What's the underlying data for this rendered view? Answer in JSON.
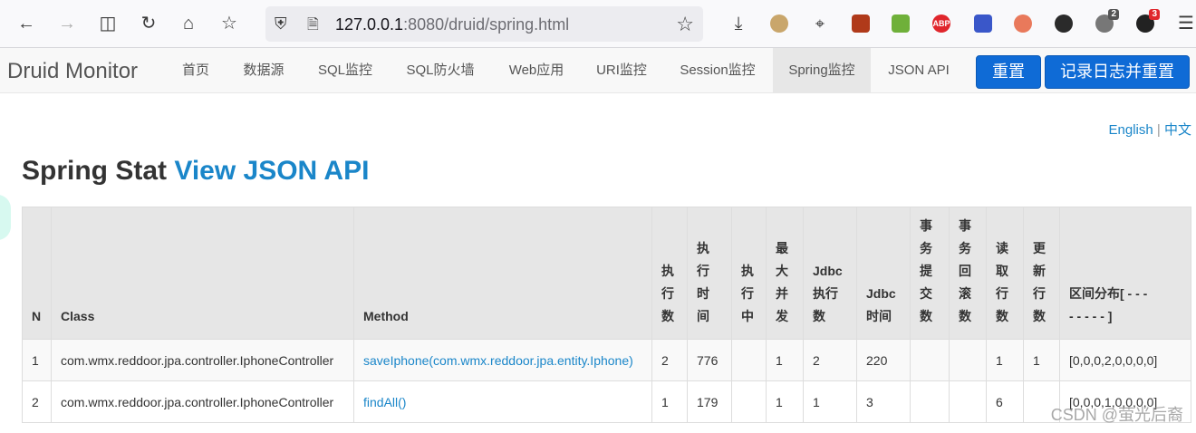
{
  "browser": {
    "url_host": "127.0.0.1",
    "url_rest": ":8080/druid/spring.html",
    "extensions": [
      {
        "name": "download-icon"
      },
      {
        "name": "extension-dog-icon"
      },
      {
        "name": "crop-icon"
      },
      {
        "name": "extension-sun-icon"
      },
      {
        "name": "extension-puzzle-icon"
      },
      {
        "name": "adblock-icon",
        "label": "ABP"
      },
      {
        "name": "extension-translate-icon"
      },
      {
        "name": "extension-tree-icon"
      },
      {
        "name": "extension-dots-icon"
      },
      {
        "name": "extension-ring-icon",
        "badge": "2"
      },
      {
        "name": "extension-face-icon",
        "badge": "3"
      }
    ]
  },
  "header": {
    "brand": "Druid Monitor",
    "nav": [
      "首页",
      "数据源",
      "SQL监控",
      "SQL防火墙",
      "Web应用",
      "URI监控",
      "Session监控",
      "Spring监控",
      "JSON API"
    ],
    "active_nav": "Spring监控",
    "reset_label": "重置",
    "log_reset_label": "记录日志并重置"
  },
  "lang": {
    "english": "English",
    "sep": "|",
    "chinese": "中文"
  },
  "title": {
    "main": "Spring Stat",
    "link": "View JSON API"
  },
  "table": {
    "headers": [
      "N",
      "Class",
      "Method",
      "执行数",
      "执行时间",
      "执行中",
      "最大并发",
      "Jdbc执行数",
      "Jdbc时间",
      "事务提交数",
      "事务回滚数",
      "读取行数",
      "更新行数",
      "区间分布[ - - - - - - - - ]"
    ],
    "rows": [
      [
        "1",
        "com.wmx.reddoor.jpa.controller.IphoneController",
        "saveIphone(com.wmx.reddoor.jpa.entity.Iphone)",
        "2",
        "776",
        "",
        "1",
        "2",
        "220",
        "",
        "",
        "1",
        "1",
        "[0,0,0,2,0,0,0,0]"
      ],
      [
        "2",
        "com.wmx.reddoor.jpa.controller.IphoneController",
        "findAll()",
        "1",
        "179",
        "",
        "1",
        "1",
        "3",
        "",
        "",
        "6",
        "",
        "[0,0,0,1,0,0,0,0]"
      ]
    ]
  },
  "watermark": "CSDN @萤光后裔"
}
